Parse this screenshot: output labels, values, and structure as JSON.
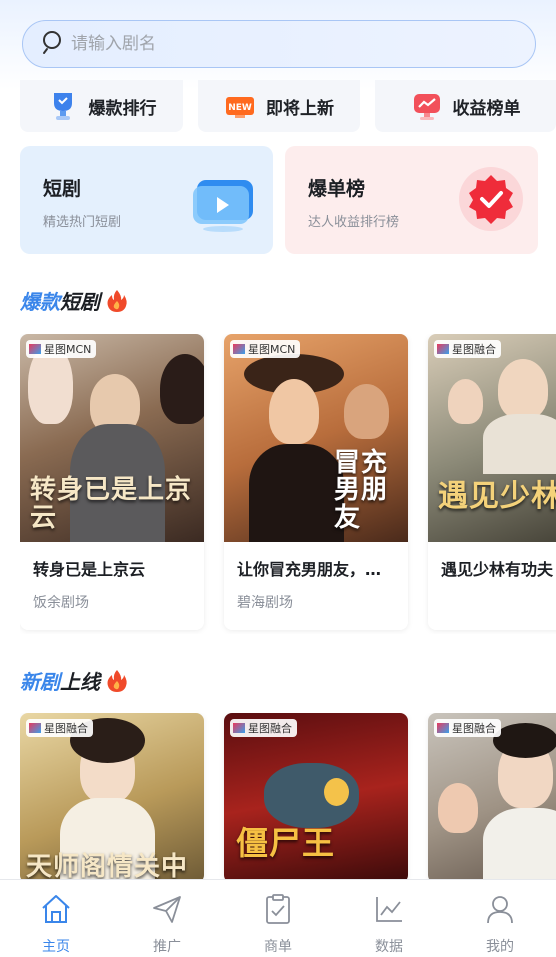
{
  "search": {
    "placeholder": "请输入剧名"
  },
  "quick_links": [
    {
      "label": "爆款排行",
      "icon": "trophy-icon"
    },
    {
      "label": "即将上新",
      "icon": "new-badge-icon"
    },
    {
      "label": "收益榜单",
      "icon": "income-chart-icon"
    }
  ],
  "feature_cards": [
    {
      "title": "短剧",
      "subtitle": "精选热门短剧",
      "icon": "play-screen-icon"
    },
    {
      "title": "爆单榜",
      "subtitle": "达人收益排行榜",
      "icon": "verified-badge-icon"
    }
  ],
  "sections": [
    {
      "title_highlight": "爆款",
      "title_rest": "短剧",
      "icon": "fire-icon",
      "dramas": [
        {
          "tag": "星图MCN",
          "poster_text": "转身已是上京云",
          "name": "转身已是上京云",
          "studio": "饭余剧场"
        },
        {
          "tag": "星图MCN",
          "poster_text": "冒充男朋友",
          "name": "让你冒充男朋友，…",
          "studio": "碧海剧场"
        },
        {
          "tag": "星图融合",
          "poster_text": "遇见少林",
          "name": "遇见少林有功夫",
          "studio": ""
        }
      ]
    },
    {
      "title_highlight": "新剧",
      "title_rest": "上线",
      "icon": "fire-icon",
      "dramas": [
        {
          "tag": "星图融合",
          "poster_text": "天师阁情关中"
        },
        {
          "tag": "星图融合",
          "poster_text": "僵尸王"
        },
        {
          "tag": "星图融合",
          "poster_text": ""
        }
      ]
    }
  ],
  "tabbar": [
    {
      "label": "主页",
      "icon": "home-icon",
      "active": true
    },
    {
      "label": "推广",
      "icon": "paper-plane-icon",
      "active": false
    },
    {
      "label": "商单",
      "icon": "clipboard-check-icon",
      "active": false
    },
    {
      "label": "数据",
      "icon": "line-chart-icon",
      "active": false
    },
    {
      "label": "我的",
      "icon": "user-icon",
      "active": false
    }
  ],
  "colors": {
    "accent": "#3a86ea",
    "card_blue": "#e4f0fd",
    "card_pink": "#fdeded",
    "text_dark": "#1c1f24",
    "text_muted": "#8a8f99"
  }
}
